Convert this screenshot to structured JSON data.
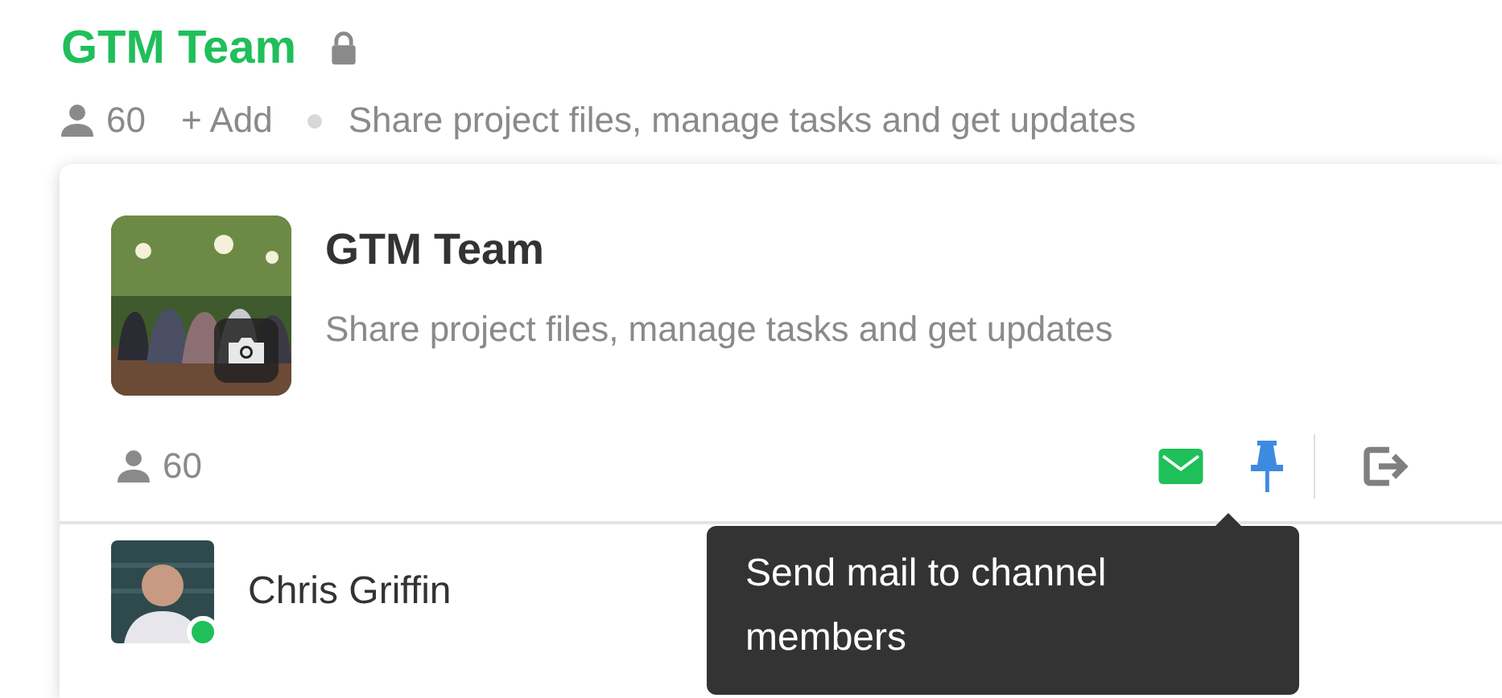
{
  "header": {
    "title": "GTM Team",
    "locked": true,
    "member_count": "60",
    "add_label": "+ Add",
    "description": "Share project files, manage tasks and get updates"
  },
  "card": {
    "title": "GTM Team",
    "description": "Share project files, manage tasks and get updates",
    "member_count": "60",
    "actions": [
      {
        "kind": "mail"
      },
      {
        "kind": "pin"
      },
      {
        "kind": "leave"
      }
    ]
  },
  "members": [
    {
      "name": "Chris Griffin",
      "online": true
    }
  ],
  "tooltip": {
    "text": "Send mail to channel members"
  }
}
